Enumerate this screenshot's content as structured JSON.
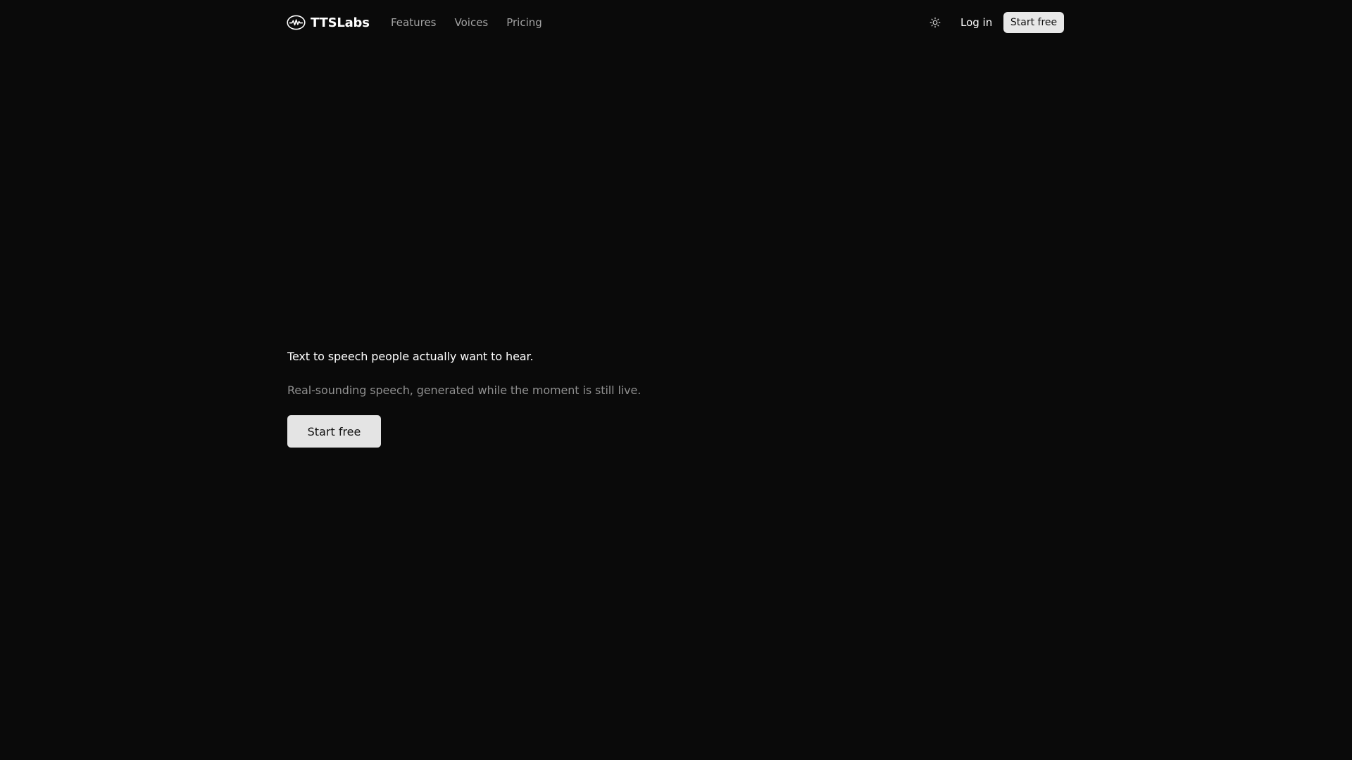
{
  "header": {
    "brand": {
      "name": "TTSLabs",
      "icon": "waveform-logo-icon"
    },
    "nav": [
      {
        "label": "Features"
      },
      {
        "label": "Voices"
      },
      {
        "label": "Pricing"
      }
    ],
    "theme_toggle_icon": "sun-icon",
    "login_label": "Log in",
    "cta_label": "Start free"
  },
  "hero": {
    "title": "Text to speech people actually want to hear.",
    "subtitle": "Real-sounding speech, generated while the moment is still live.",
    "cta_label": "Start free"
  },
  "colors": {
    "background": "#0a0a0a",
    "text_primary": "#ffffff",
    "text_muted": "#a3a3a3",
    "button_bg": "#e8e8e8",
    "button_text": "#111111"
  }
}
